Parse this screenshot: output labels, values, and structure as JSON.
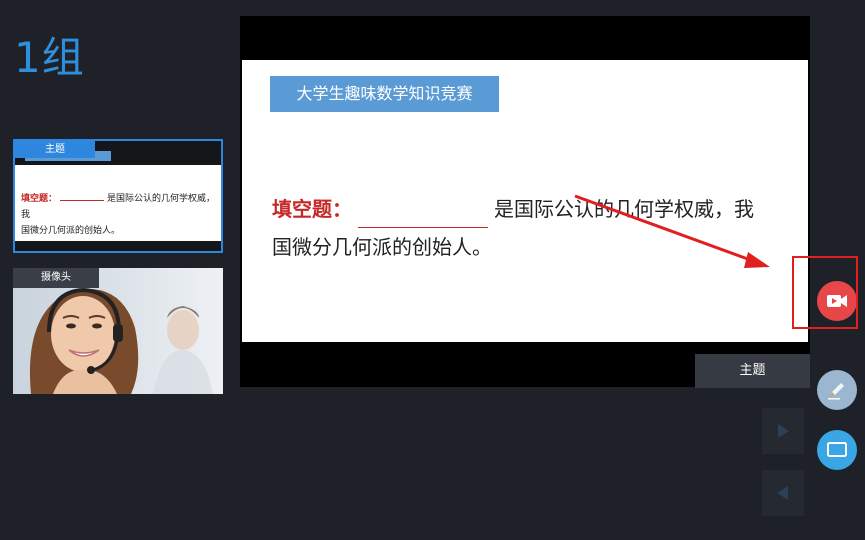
{
  "group": {
    "title": "1组"
  },
  "slide": {
    "title": "大学生趣味数学知识竞赛",
    "question_label": "填空题：",
    "question_text_line1": "是国际公认的几何学权威，我",
    "question_text_line2": "国微分几何派的创始人。"
  },
  "thumbnails": {
    "slide_tag": "主题",
    "slide_question_label": "填空题：",
    "slide_question_line1": "是国际公认的几何学权威，我",
    "slide_question_line2": "国微分几何派的创始人。",
    "camera_tag": "摄像头"
  },
  "controls": {
    "theme_label": "主题",
    "record_icon": "video-record-icon",
    "pen_icon": "pen-icon",
    "screen_icon": "screen-share-icon",
    "next_icon": "play-next-icon",
    "prev_icon": "play-prev-icon"
  },
  "colors": {
    "accent_blue": "#2e86de",
    "record_red": "#e8474a",
    "highlight_red": "#e02020",
    "slide_title_bg": "#5b9bd5"
  }
}
